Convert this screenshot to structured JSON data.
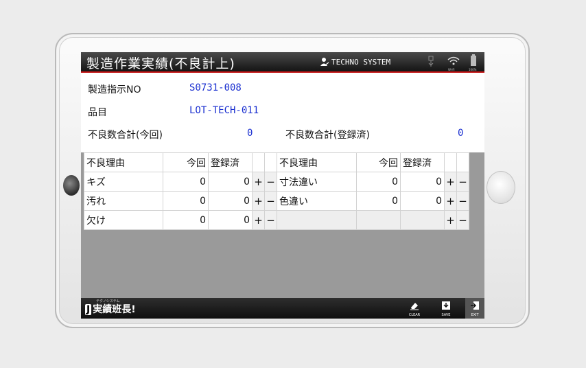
{
  "app": {
    "title": "製造作業実績(不良計上)",
    "brand": "TECHNO SYSTEM",
    "status_icons": [
      "usb-icon",
      "wifi-icon",
      "battery-icon"
    ],
    "wifi_label": "Wi-Fi",
    "battery_label": "100%"
  },
  "info": {
    "order_label": "製造指示NO",
    "order_value": "S0731-008",
    "item_label": "品目",
    "item_value": "LOT-TECH-011",
    "total_current_label": "不良数合計(今回)",
    "total_current_value": "0",
    "total_registered_label": "不良数合計(登録済)",
    "total_registered_value": "0"
  },
  "table": {
    "headers": [
      "不良理由",
      "今回",
      "登録済"
    ],
    "plus": "+",
    "minus": "−",
    "left": [
      {
        "reason": "キズ",
        "current": "0",
        "registered": "0"
      },
      {
        "reason": "汚れ",
        "current": "0",
        "registered": "0"
      },
      {
        "reason": "欠け",
        "current": "0",
        "registered": "0"
      }
    ],
    "right": [
      {
        "reason": "寸法違い",
        "current": "0",
        "registered": "0"
      },
      {
        "reason": "色違い",
        "current": "0",
        "registered": "0"
      }
    ]
  },
  "footer": {
    "logo_text": "実績班長!",
    "logo_small": "テクノシステム",
    "clear_label": "CLEAR",
    "save_label": "SAVE",
    "exit_label": "EXIT"
  },
  "colors": {
    "accent": "#c41414",
    "value_blue": "#1a2fd0"
  }
}
